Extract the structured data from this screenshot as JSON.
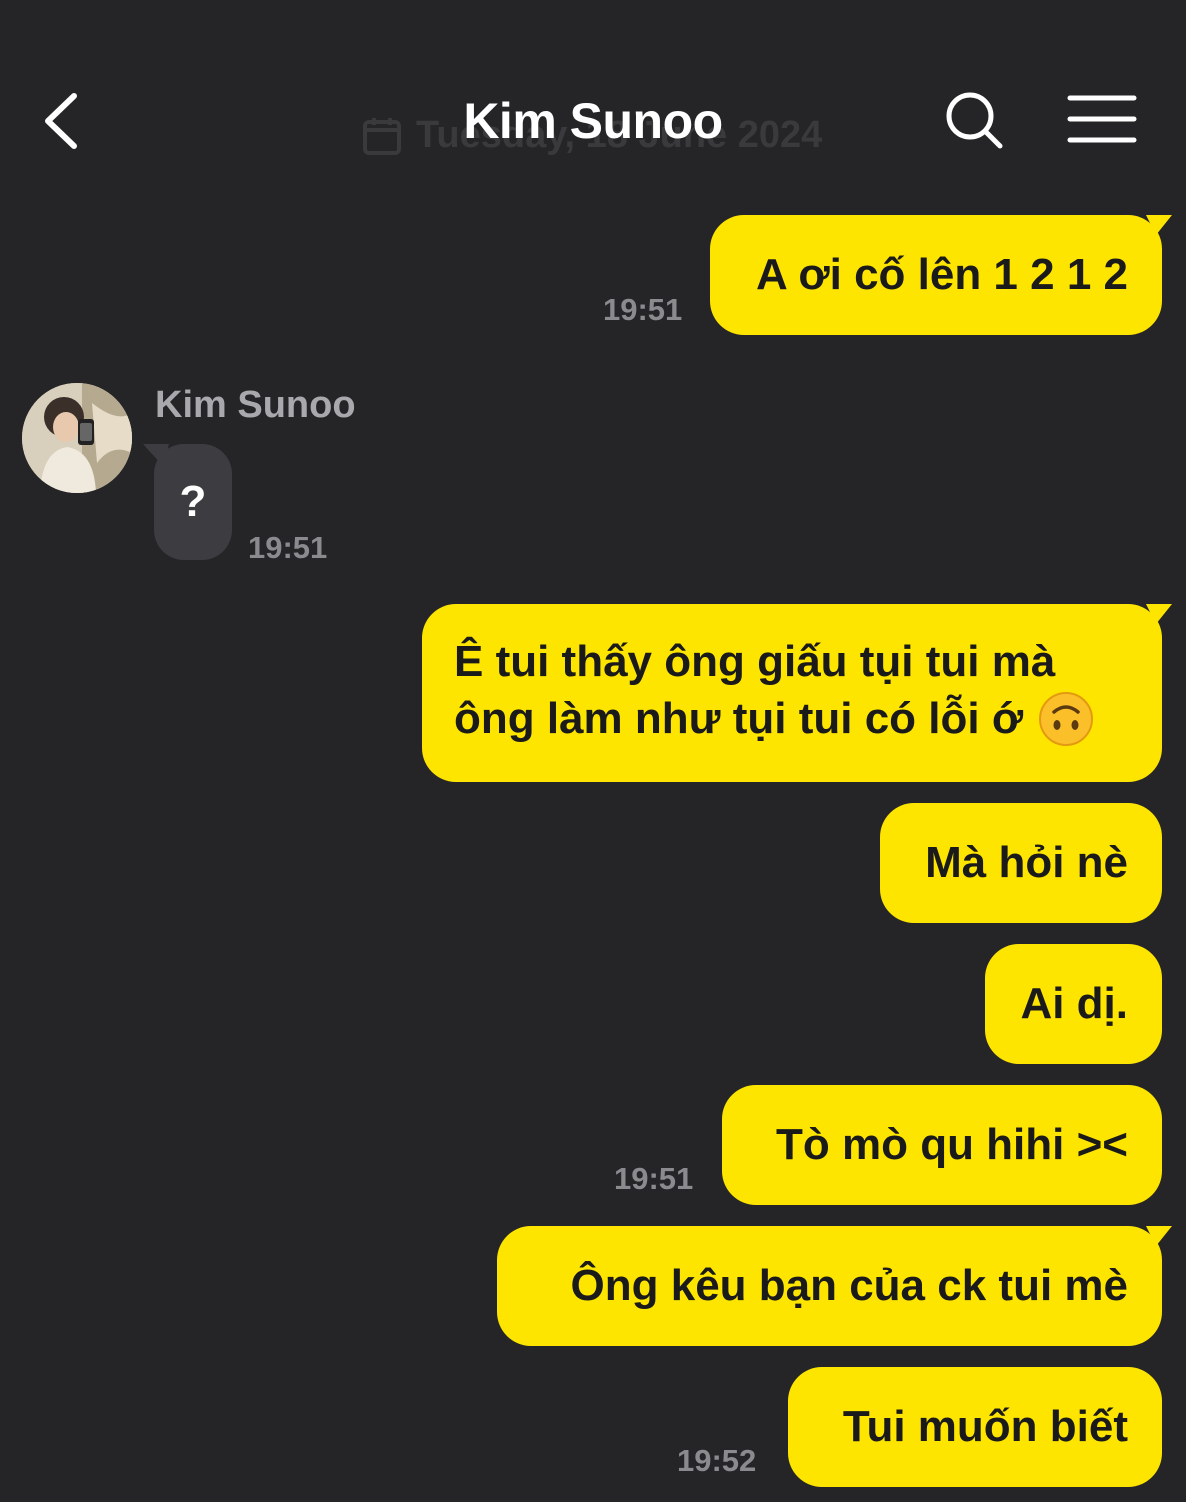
{
  "header": {
    "title": "Kim Sunoo",
    "ghost_date": "Tuesday, 18 June 2024"
  },
  "icons": {
    "back": "chevron-left-icon",
    "search": "search-icon",
    "menu": "hamburger-menu-icon"
  },
  "colors": {
    "background": "#252527",
    "outgoing_bubble": "#fee500",
    "incoming_bubble": "#3d3d41",
    "timestamp": "#8b8b8f"
  },
  "messages": [
    {
      "direction": "out",
      "text": "A ơi cố lên 1 2 1 2",
      "time": "19:51"
    },
    {
      "direction": "in",
      "sender": "Kim Sunoo",
      "text": "?",
      "time": "19:51"
    },
    {
      "direction": "out",
      "line1": "Ê tui thấy ông giấu tụi tui mà",
      "line2": "ông làm như tụi tui có lỗi ớ",
      "emoji": "🙃"
    },
    {
      "direction": "out",
      "text": "Mà hỏi nè"
    },
    {
      "direction": "out",
      "text": "Ai dị."
    },
    {
      "direction": "out",
      "text": "Tò mò qu hihi ><",
      "time": "19:51"
    },
    {
      "direction": "out",
      "text": "Ông kêu bạn của ck tui mè"
    },
    {
      "direction": "out",
      "text": "Tui muốn biết",
      "time": "19:52"
    }
  ]
}
